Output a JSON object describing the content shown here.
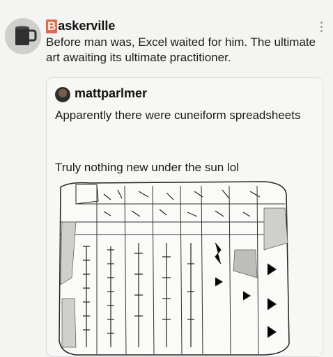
{
  "post": {
    "author_initial": "B",
    "author_rest": "askerville",
    "text": "Before man was, Excel waited for him. The ultimate art awaiting its ultimate practitioner.",
    "icons": {
      "avatar": "coffee-mug-avatar",
      "more": "more-vertical-icon"
    }
  },
  "quoted": {
    "author": "mattparlmer",
    "text_line1": "Apparently there were cuneiform spreadsheets",
    "text_line2": "Truly nothing new under the sun lol",
    "image": "cuneiform-tablet-drawing"
  },
  "colors": {
    "initial_badge": "#e06a4e",
    "background": "#f4f4f2"
  }
}
